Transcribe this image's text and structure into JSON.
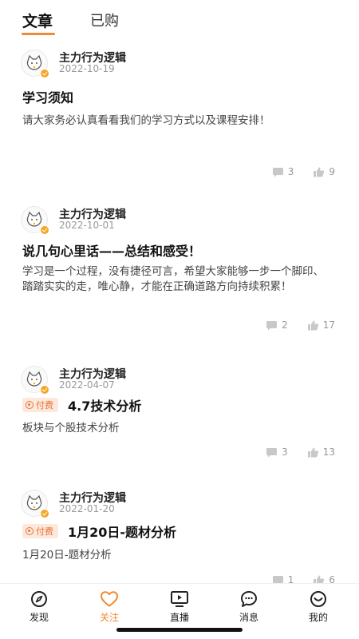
{
  "tabs": [
    {
      "label": "文章",
      "active": true
    },
    {
      "label": "已购",
      "active": false
    }
  ],
  "articles": [
    {
      "author": "主力行为逻辑",
      "date": "2022-10-19",
      "paid_label": "",
      "title": "学习须知",
      "summary": "请大家务必认真看看我们的学习方式以及课程安排！",
      "comments": "3",
      "likes": "9"
    },
    {
      "author": "主力行为逻辑",
      "date": "2022-10-01",
      "paid_label": "",
      "title": "说几句心里话——总结和感受！",
      "summary": "学习是一个过程，没有捷径可言，希望大家能够一步一个脚印、踏踏实实的走，唯心静，才能在正确道路方向持续积累！",
      "comments": "2",
      "likes": "17"
    },
    {
      "author": "主力行为逻辑",
      "date": "2022-04-07",
      "paid_label": "付费",
      "title": "4.7技术分析",
      "summary": "板块与个股技术分析",
      "comments": "3",
      "likes": "13"
    },
    {
      "author": "主力行为逻辑",
      "date": "2022-01-20",
      "paid_label": "付费",
      "title": "1月20日-题材分析",
      "summary": "1月20日-题材分析",
      "comments": "1",
      "likes": "6"
    }
  ],
  "bottom_nav": [
    {
      "label": "发现",
      "icon": "compass-icon",
      "active": false
    },
    {
      "label": "关注",
      "icon": "heart-icon",
      "active": true
    },
    {
      "label": "直播",
      "icon": "tv-play-icon",
      "active": false
    },
    {
      "label": "消息",
      "icon": "chat-bubble-icon",
      "active": false
    },
    {
      "label": "我的",
      "icon": "smile-face-icon",
      "active": false
    }
  ],
  "colors": {
    "accent": "#f08a36",
    "paid_bg": "#fde9dc",
    "paid_text": "#e8733a",
    "muted": "#999999"
  }
}
